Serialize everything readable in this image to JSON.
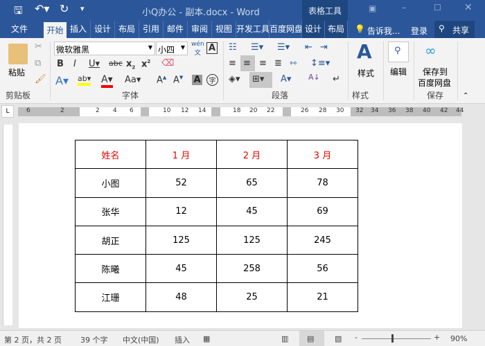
{
  "title": "小Q办公 - 副本.docx - Word",
  "context_tab": "表格工具",
  "tabs": [
    "文件",
    "开始",
    "插入",
    "设计",
    "布局",
    "引用",
    "邮件",
    "审阅",
    "视图",
    "开发工具",
    "百度网盘",
    "设计",
    "布局"
  ],
  "tell_me": "告诉我...",
  "login": "登录",
  "share": "共享",
  "ribbon": {
    "paste": "粘贴",
    "clipboard": "剪贴板",
    "font_name": "微软雅黑",
    "font_size": "小四",
    "font_group": "字体",
    "para_group": "段落",
    "styles": "样式",
    "styles_group": "样式",
    "edit": "编辑",
    "save_baidu_1": "保存到",
    "save_baidu_2": "百度网盘",
    "save_group": "保存"
  },
  "ruler": [
    "6",
    "2",
    "2",
    "4",
    "6",
    "10",
    "12",
    "14",
    "18",
    "20",
    "22",
    "26",
    "28",
    "30",
    "32",
    "34",
    "36",
    "38",
    "40",
    "42",
    "44"
  ],
  "table": {
    "header": [
      "姓名",
      "1 月",
      "2 月",
      "3 月"
    ],
    "rows": [
      [
        "小图",
        "52",
        "65",
        "78"
      ],
      [
        "张华",
        "12",
        "45",
        "69"
      ],
      [
        "胡正",
        "125",
        "125",
        "245"
      ],
      [
        "陈曦",
        "45",
        "258",
        "56"
      ],
      [
        "江珊",
        "48",
        "25",
        "21"
      ]
    ]
  },
  "status": {
    "page": "第 2 页，共 2 页",
    "words": "39 个字",
    "lang": "中文(中国)",
    "mode": "插入",
    "zoom": "90%"
  },
  "colors": {
    "brand": "#2b579a",
    "header_text": "#e00000"
  }
}
